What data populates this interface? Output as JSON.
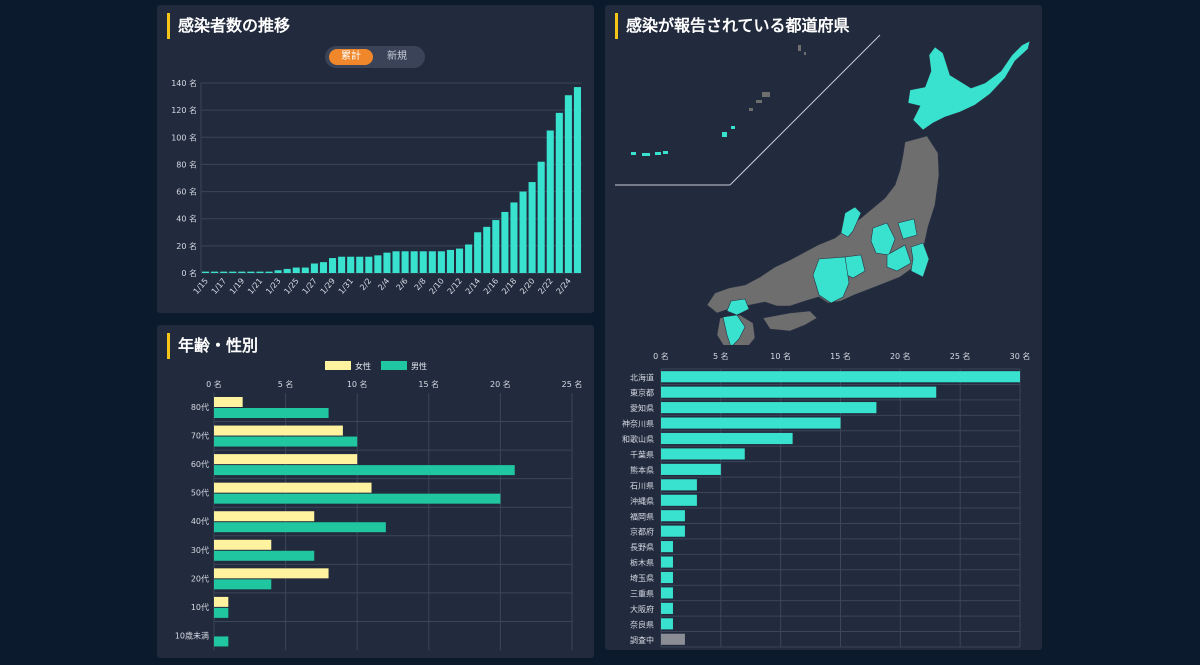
{
  "colors": {
    "teal": "#38e2cf",
    "female": "#fff3a0",
    "male": "#20c69f",
    "unknown": "#8a8d96",
    "accent": "#f5c518",
    "toggle_active": "#f0872a"
  },
  "trend": {
    "title": "感染者数の推移",
    "toggle": {
      "active": "累計",
      "inactive": "新規"
    }
  },
  "age": {
    "title": "年齢・性別",
    "legend": {
      "female": "女性",
      "male": "男性"
    }
  },
  "pref": {
    "title": "感染が報告されている都道府県"
  },
  "chart_data": [
    {
      "type": "bar",
      "categories": [
        "1/15",
        "1/16",
        "1/17",
        "1/18",
        "1/19",
        "1/20",
        "1/21",
        "1/22",
        "1/23",
        "1/24",
        "1/25",
        "1/26",
        "1/27",
        "1/28",
        "1/29",
        "1/30",
        "1/31",
        "2/1",
        "2/2",
        "2/3",
        "2/4",
        "2/5",
        "2/6",
        "2/7",
        "2/8",
        "2/9",
        "2/10",
        "2/11",
        "2/12",
        "2/13",
        "2/14",
        "2/15",
        "2/16",
        "2/17",
        "2/18",
        "2/19",
        "2/20",
        "2/21",
        "2/22",
        "2/23",
        "2/24",
        "2/25"
      ],
      "x_tick_labels": [
        "1/15",
        "1/17",
        "1/19",
        "1/21",
        "1/23",
        "1/25",
        "1/27",
        "1/29",
        "1/31",
        "2/2",
        "2/4",
        "2/6",
        "2/8",
        "2/10",
        "2/12",
        "2/14",
        "2/16",
        "2/18",
        "2/20",
        "2/22",
        "2/24"
      ],
      "values": [
        1,
        1,
        1,
        1,
        1,
        1,
        1,
        1,
        2,
        3,
        4,
        4,
        7,
        8,
        11,
        12,
        12,
        12,
        12,
        13,
        15,
        16,
        16,
        16,
        16,
        16,
        16,
        17,
        18,
        21,
        30,
        34,
        39,
        45,
        52,
        60,
        67,
        82,
        105,
        118,
        131,
        137
      ],
      "ylim": [
        0,
        140
      ],
      "y_ticks": [
        "0 名",
        "20 名",
        "40 名",
        "60 名",
        "80 名",
        "100 名",
        "120 名",
        "140 名"
      ],
      "grid": true
    },
    {
      "type": "bar",
      "orientation": "horizontal",
      "categories": [
        "80代",
        "70代",
        "60代",
        "50代",
        "40代",
        "30代",
        "20代",
        "10代",
        "10歳未満"
      ],
      "series": [
        {
          "name": "女性",
          "values": [
            2,
            9,
            10,
            11,
            7,
            4,
            8,
            1,
            0
          ]
        },
        {
          "name": "男性",
          "values": [
            8,
            10,
            21,
            20,
            12,
            7,
            4,
            1,
            1
          ]
        }
      ],
      "xlim": [
        0,
        25
      ],
      "x_ticks": [
        "0 名",
        "5 名",
        "10 名",
        "15 名",
        "20 名",
        "25 名"
      ],
      "legend": "top",
      "grid": true
    },
    {
      "type": "bar",
      "orientation": "horizontal",
      "categories": [
        "北海道",
        "東京都",
        "愛知県",
        "神奈川県",
        "和歌山県",
        "千葉県",
        "熊本県",
        "石川県",
        "沖縄県",
        "福岡県",
        "京都府",
        "長野県",
        "栃木県",
        "埼玉県",
        "三重県",
        "大阪府",
        "奈良県",
        "調査中"
      ],
      "values": [
        30,
        23,
        18,
        15,
        11,
        7,
        5,
        3,
        3,
        2,
        2,
        1,
        1,
        1,
        1,
        1,
        1,
        2
      ],
      "xlim": [
        0,
        30
      ],
      "x_ticks": [
        "0 名",
        "5 名",
        "10 名",
        "15 名",
        "20 名",
        "25 名",
        "30 名"
      ],
      "grid": true
    }
  ]
}
